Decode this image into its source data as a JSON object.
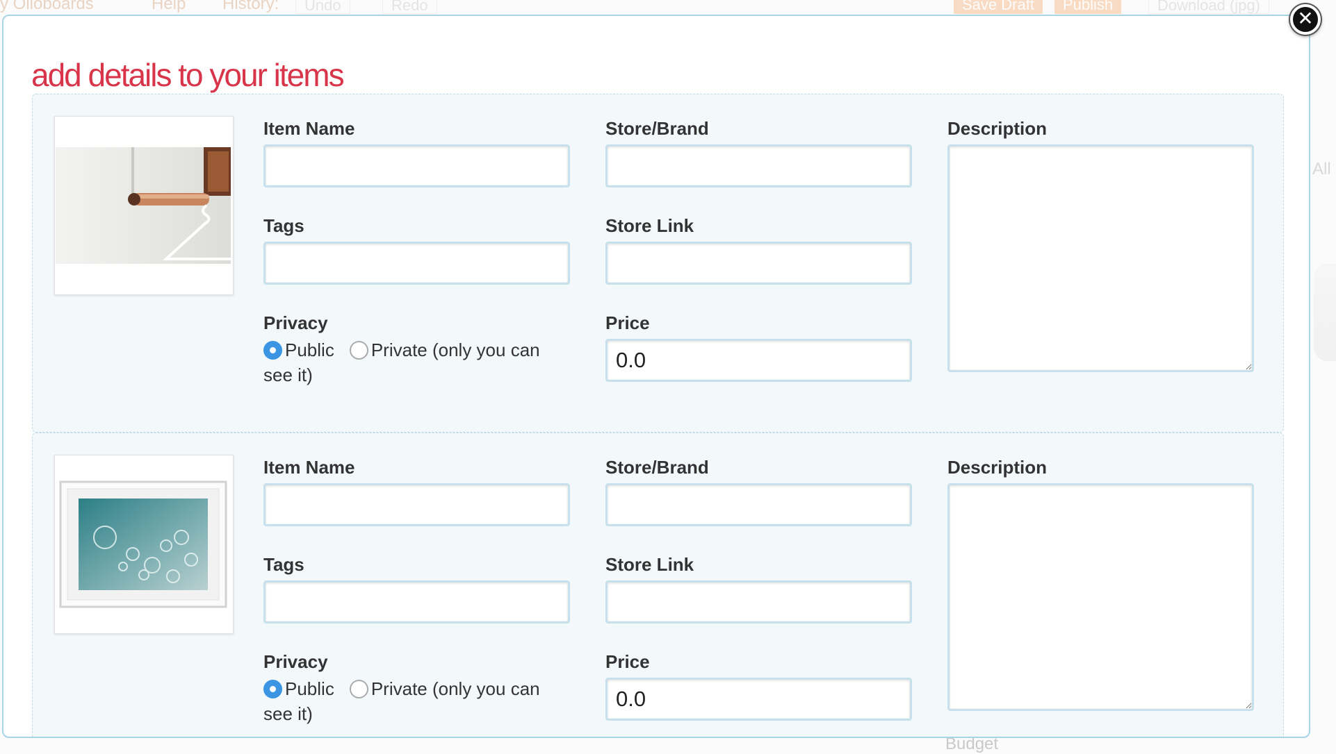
{
  "background": {
    "toolbar": {
      "boards_label": "y Olioboards",
      "help_label": "Help",
      "history_label": "History:",
      "undo_label": "Undo",
      "redo_label": "Redo",
      "save_draft_label": "Save Draft",
      "publish_label": "Publish",
      "download_label": "Download (jpg)"
    },
    "side_label": "All",
    "budget_label": "Budget"
  },
  "modal": {
    "title": "add details to your items",
    "close_icon": "close-icon",
    "colors": {
      "title": "#d8354a",
      "border": "#a9d3e6",
      "card_bg": "#f3f9fb",
      "radio_on": "#3b95e3"
    }
  },
  "items": [
    {
      "thumbnail": "copper-rail-hanger",
      "labels": {
        "item_name": "Item Name",
        "store_brand": "Store/Brand",
        "description": "Description",
        "tags": "Tags",
        "store_link": "Store Link",
        "privacy": "Privacy",
        "price": "Price"
      },
      "values": {
        "item_name": "",
        "store_brand": "",
        "description": "",
        "tags": "",
        "store_link": "",
        "price": "0.0"
      },
      "privacy_options": {
        "public": "Public",
        "private": "Private (only you can see it)",
        "selected": "public"
      }
    },
    {
      "thumbnail": "framed-bubbles-print",
      "labels": {
        "item_name": "Item Name",
        "store_brand": "Store/Brand",
        "description": "Description",
        "tags": "Tags",
        "store_link": "Store Link",
        "privacy": "Privacy",
        "price": "Price"
      },
      "values": {
        "item_name": "",
        "store_brand": "",
        "description": "",
        "tags": "",
        "store_link": "",
        "price": "0.0"
      },
      "privacy_options": {
        "public": "Public",
        "private": "Private (only you can see it)",
        "selected": "public"
      }
    }
  ]
}
